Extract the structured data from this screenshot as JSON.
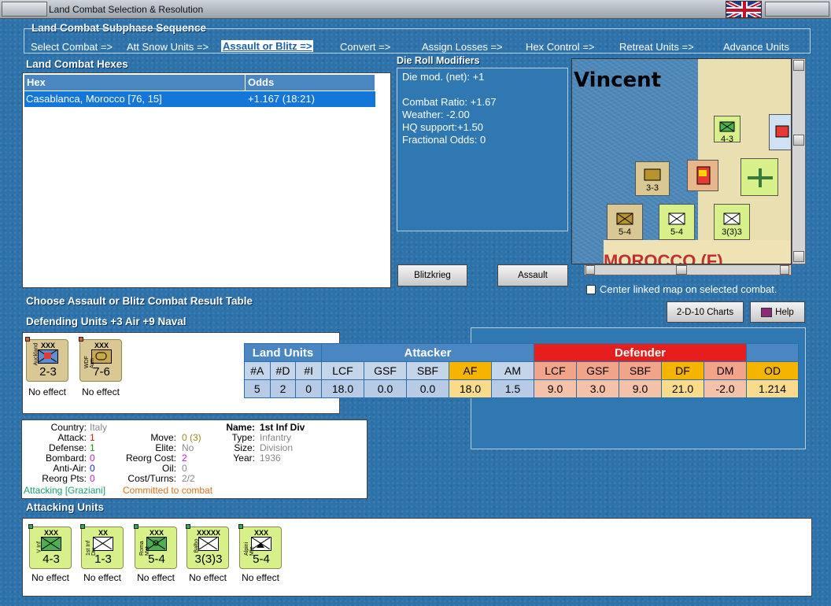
{
  "window": {
    "title": "Land Combat Selection & Resolution"
  },
  "subphase": {
    "title": "Land Combat Subphase Sequence",
    "steps": [
      "Select Combat =>",
      "Att Snow Units =>",
      "Assault or Blitz =>",
      "Convert =>",
      "Assign Losses =>",
      "Hex Control =>",
      "Retreat Units =>",
      "Advance Units"
    ],
    "active_index": 2
  },
  "hexes": {
    "title": "Land Combat Hexes",
    "col_hex": "Hex",
    "col_odds": "Odds",
    "rows": [
      {
        "hex": "Casablanca, Morocco [76, 15]",
        "odds": "+1.167 (18:21)"
      }
    ]
  },
  "die_roll": {
    "title": "Die Roll Modifiers",
    "net": "Die mod. (net): +1",
    "lines": [
      "Combat Ratio: +1.67",
      "Weather: -2.00",
      "HQ support:+1.50",
      "Fractional Odds: 0"
    ]
  },
  "map": {
    "label": "Vincent",
    "region": "MOROCCO (F)"
  },
  "buttons": {
    "blitzkrieg": "Blitzkrieg",
    "assault": "Assault",
    "charts": "2-D-10 Charts",
    "help": "Help"
  },
  "center_map": "Center linked map on selected combat.",
  "choose_label": "Choose Assault or Blitz Combat Result Table",
  "defending_label": "Defending Units +3 Air +9 Naval",
  "attacking_label": "Attacking Units",
  "defending_units": [
    {
      "size": "XXX",
      "side": "Auckland",
      "values": "2-3",
      "effect": "No effect"
    },
    {
      "size": "XXX",
      "side": "WDF Arm",
      "values": "7-6",
      "effect": "No effect"
    }
  ],
  "attacking_units": [
    {
      "size": "XXX",
      "side": "V Inf",
      "values": "4-3",
      "effect": "No effect"
    },
    {
      "size": "XX",
      "side": "1st Inf Div",
      "values": "1-3",
      "effect": "No effect"
    },
    {
      "size": "XXX",
      "side": "Roma Mot",
      "values": "5-4",
      "effect": "No effect"
    },
    {
      "size": "XXXXX",
      "side": "Balbo",
      "values": "3(3)3",
      "effect": "No effect"
    },
    {
      "size": "XXX",
      "side": "Alpini Mtn",
      "values": "5-4",
      "effect": "No effect"
    }
  ],
  "combat_table": {
    "land_units": "Land Units",
    "attacker": "Attacker",
    "defender": "Defender",
    "headers": [
      "#A",
      "#D",
      "#I",
      "LCF",
      "GSF",
      "SBF",
      "AF",
      "AM",
      "LCF",
      "GSF",
      "SBF",
      "DF",
      "DM",
      "OD"
    ],
    "values": [
      "5",
      "2",
      "0",
      "18.0",
      "0.0",
      "0.0",
      "18.0",
      "1.5",
      "9.0",
      "3.0",
      "9.0",
      "21.0",
      "-2.0",
      "1.214"
    ]
  },
  "unit_info": {
    "country_k": "Country:",
    "country": "Italy",
    "attack_k": "Attack:",
    "attack": "1",
    "defense_k": "Defense:",
    "defense": "1",
    "bombard_k": "Bombard:",
    "bombard": "0",
    "antiair_k": "Anti-Air:",
    "antiair": "0",
    "reorg_k": "Reorg Pts:",
    "reorg": "0",
    "move_k": "Move:",
    "move": "0 (3)",
    "elite_k": "Elite:",
    "elite": "No",
    "reorgcost_k": "Reorg Cost:",
    "reorgcost": "2",
    "oil_k": "Oil:",
    "oil": "0",
    "costturns_k": "Cost/Turns:",
    "costturns": "2/2",
    "name_k": "Name:",
    "name": "1st Inf Div",
    "type_k": "Type:",
    "type": "Infantry",
    "size_k": "Size:",
    "size": "Division",
    "year_k": "Year:",
    "year": "1936",
    "status_attacking": "Attacking [Graziani]",
    "status_committed": "Committed to combat"
  },
  "colors": {
    "panel_blue": "#2c6fa6",
    "header_blue": "#4a86c2",
    "defender_red": "#e61e1e",
    "amber": "#f5b400"
  }
}
